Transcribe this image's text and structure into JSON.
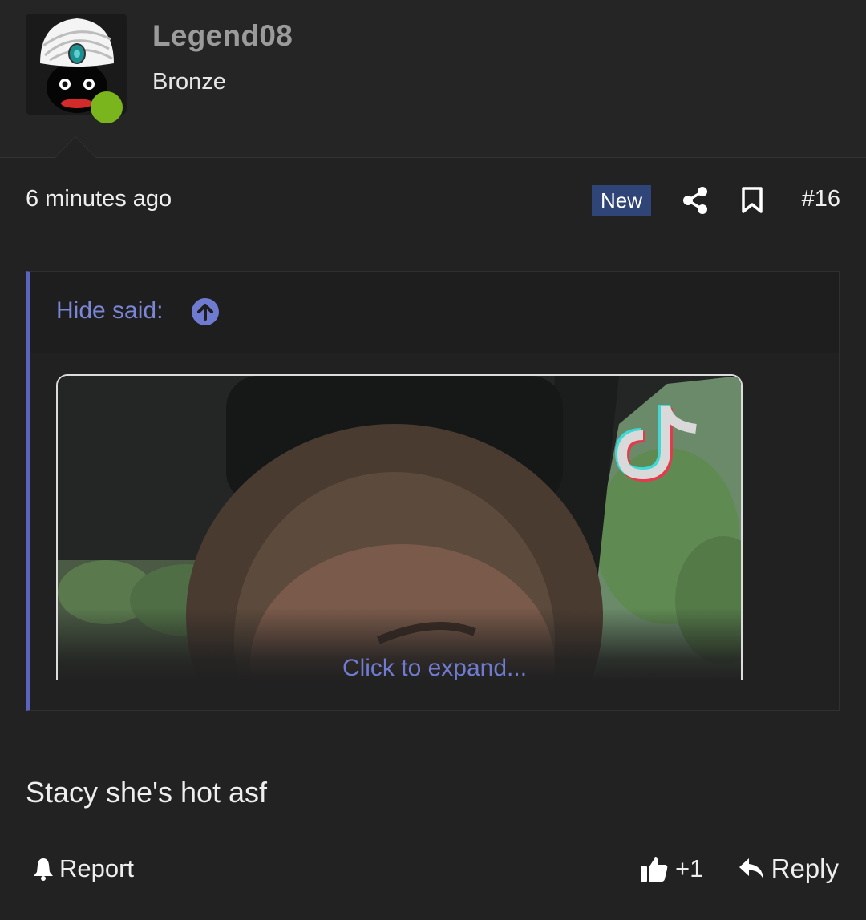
{
  "user": {
    "name": "Legend08",
    "title": "Bronze",
    "online": true,
    "avatar_icon": "turban-avatar-icon"
  },
  "post": {
    "time": "6 minutes ago",
    "badge": "New",
    "number": "#16",
    "message": "Stacy she's hot asf"
  },
  "quote": {
    "author": "Hide said:",
    "expand": "Click to expand...",
    "media_icon": "tiktok-logo-icon"
  },
  "actions": {
    "report": "Report",
    "like_count": "+1",
    "reply": "Reply"
  },
  "colors": {
    "accent": "#5b65c0",
    "link": "#7b86d6",
    "badge_bg": "#2f4577",
    "online": "#7ab51d",
    "background": "#222222"
  }
}
